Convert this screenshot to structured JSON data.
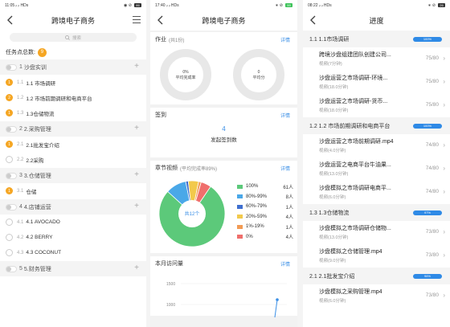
{
  "p1": {
    "status_time": "11:05",
    "status_signal": "ᵢₗ ᵢₗ HDs",
    "status_right": "◉ ⊘",
    "battery": "86",
    "title": "跨境电子商务",
    "search_placeholder": "搜索",
    "count_label": "任务点总数:",
    "count_value": "9",
    "chapters": [
      {
        "num": "1",
        "title": "沙盘实训",
        "lessons": [
          {
            "mark": "1",
            "num": "1.1",
            "title": "1.1 市场调研",
            "done": true
          },
          {
            "mark": "2",
            "num": "1.2",
            "title": "1.2 市场前期调研和电商平台",
            "done": true
          },
          {
            "mark": "1",
            "num": "1.3",
            "title": "1.3仓储物流",
            "done": true
          }
        ]
      },
      {
        "num": "2",
        "title": "2.采购管理",
        "lessons": [
          {
            "mark": "1",
            "num": "2.1",
            "title": "2.1批发宝介绍",
            "done": true
          },
          {
            "mark": "",
            "num": "2.2",
            "title": "2.2采购",
            "done": false
          }
        ]
      },
      {
        "num": "3",
        "title": "3.仓储管理",
        "lessons": [
          {
            "mark": "1",
            "num": "3.1",
            "title": "仓储",
            "done": true
          }
        ]
      },
      {
        "num": "4",
        "title": "4.店铺运营",
        "lessons": [
          {
            "mark": "",
            "num": "4.1",
            "title": "4.1 AVOCADO",
            "done": false
          },
          {
            "mark": "",
            "num": "4.2",
            "title": "4.2 BERRY",
            "done": false
          },
          {
            "mark": "",
            "num": "4.3",
            "title": "4.3 COCONUT",
            "done": false
          }
        ]
      },
      {
        "num": "5",
        "title": "5.财务管理",
        "lessons": []
      }
    ]
  },
  "p2": {
    "status_time": "17:40",
    "status_signal": "ᵢₗ ᵢₗ HDs",
    "status_right": "∗ ⊘",
    "battery": "59",
    "title": "跨境电子商务",
    "homework_title": "作业",
    "homework_sub": "(共1份)",
    "detail": "详情",
    "ring1_value": "0%",
    "ring1_label": "平均完成率",
    "ring2_value": "0",
    "ring2_label": "平均分",
    "sign_title": "签到",
    "sign_value": "4",
    "sign_label": "发起签到数",
    "video_title": "章节视频",
    "video_sub": "(平均完成率89%)",
    "pie_center": "共12个",
    "visit_title": "本月访问量",
    "y_ticks": [
      "1500",
      "1000"
    ]
  },
  "chart_data": {
    "type": "pie",
    "categories": [
      "100%",
      "80%-99%",
      "60%-79%",
      "20%-59%",
      "1%-19%",
      "0%"
    ],
    "values": [
      61,
      8,
      1,
      4,
      1,
      4
    ],
    "value_labels": [
      "61人",
      "8人",
      "1人",
      "4人",
      "1人",
      "4人"
    ],
    "colors": [
      "#5cc97a",
      "#4aa8e8",
      "#3f6fcf",
      "#f2c94c",
      "#f29b54",
      "#ef6f6c"
    ],
    "center_label": "共12个"
  },
  "p3": {
    "status_time": "08:22",
    "status_signal": "ᵢₗ ᵢₗ HDs",
    "status_right": "∗ ⊘",
    "battery": "26",
    "title": "进度",
    "sections": [
      {
        "title": "1.1 1.1市场调研",
        "progress": "100%",
        "items": [
          {
            "name": "跨境沙盘组建团队创建公司...",
            "dur": "视频(7分钟)",
            "score": "75/80"
          },
          {
            "name": "沙盘运营之市场调研-环境...",
            "dur": "视频(18.0分钟)",
            "score": "75/80"
          },
          {
            "name": "沙盘运营之市场调研-货币...",
            "dur": "视频(18.0分钟)",
            "score": "75/80"
          }
        ]
      },
      {
        "title": "1.2 1.2 市场前期调研和电商平台",
        "progress": "100%",
        "items": [
          {
            "name": "沙盘运营之市场前期调研.mp4",
            "dur": "视频(4.0分钟)",
            "score": "74/80"
          },
          {
            "name": "沙盘运营之电商平台牛油果...",
            "dur": "视频(13.0分钟)",
            "score": "74/80"
          },
          {
            "name": "沙盘模拟之市场调研电商平...",
            "dur": "视频(6.0分钟)",
            "score": "74/80"
          }
        ]
      },
      {
        "title": "1.3 1.3仓储物流",
        "progress": "97%",
        "items": [
          {
            "name": "沙盘模拟之市场调研仓储物...",
            "dur": "视频(13.0分钟)",
            "score": "73/80"
          },
          {
            "name": "沙盘模拟之仓储管理.mp4",
            "dur": "视频(9.0分钟)",
            "score": "73/80"
          }
        ]
      },
      {
        "title": "2.1 2.1批发宝介绍",
        "progress": "96%",
        "items": [
          {
            "name": "沙盘模拟之采购管理.mp4",
            "dur": "视频(6.0分钟)",
            "score": "73/80"
          }
        ]
      }
    ]
  }
}
